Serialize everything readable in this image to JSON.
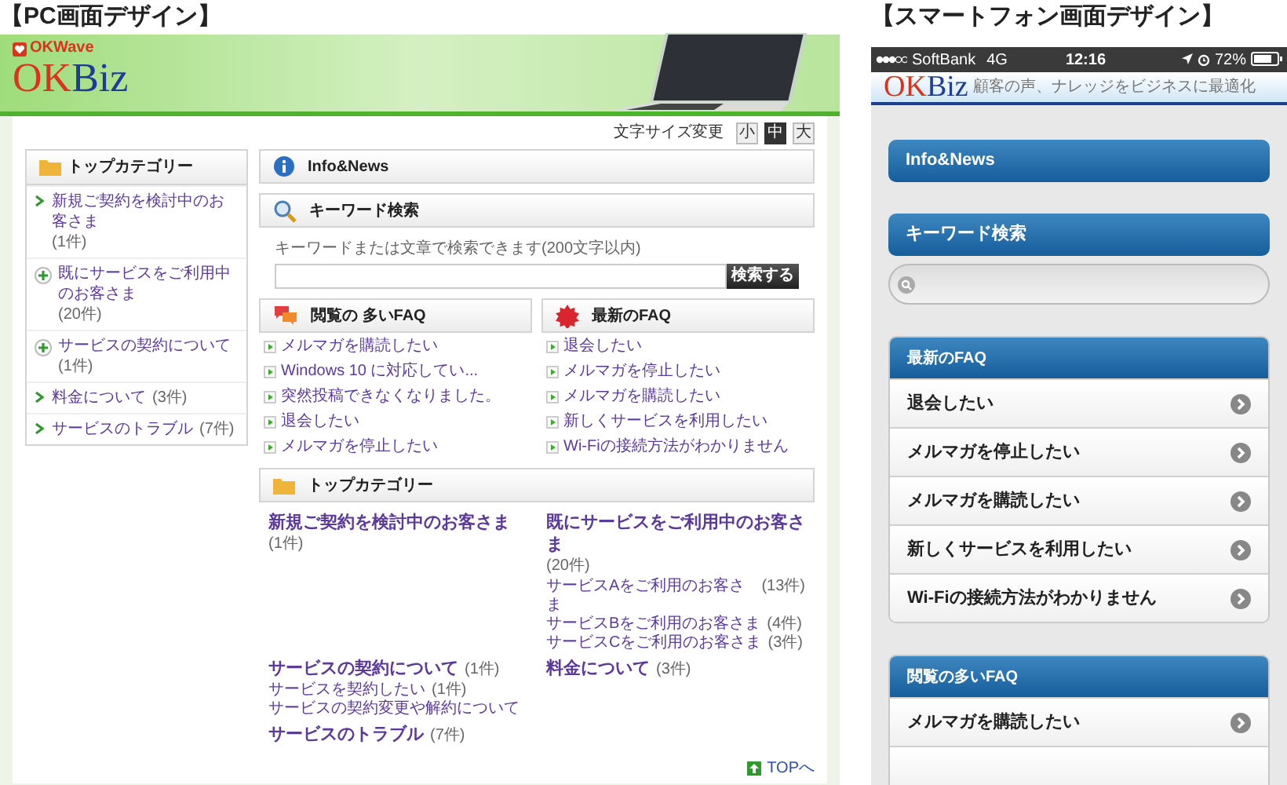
{
  "pc": {
    "title": "【PC画面デザイン】",
    "banner": {
      "brand": "OKWave",
      "logo_main": "OK",
      "logo_sub": "Biz"
    },
    "font_size": {
      "label": "文字サイズ変更",
      "options": [
        {
          "label": "小",
          "selected": false
        },
        {
          "label": "中",
          "selected": true
        },
        {
          "label": "大",
          "selected": false
        }
      ]
    },
    "sidebar": {
      "title": "トップカテゴリー",
      "items": [
        {
          "label": "新規ご契約を検討中のお客さま",
          "count": "(1件)",
          "kind": "arrow"
        },
        {
          "label": "既にサービスをご利用中のお客さま",
          "count": "(20件)",
          "kind": "plus"
        },
        {
          "label": "サービスの契約について",
          "count": "(1件)",
          "kind": "plus"
        },
        {
          "label": "料金について",
          "count": "(3件)",
          "kind": "arrow"
        },
        {
          "label": "サービスのトラブル",
          "count": "(7件)",
          "kind": "arrow"
        }
      ]
    },
    "info_title": "Info&News",
    "search": {
      "title": "キーワード検索",
      "hint": "キーワードまたは文章で検索できます(200文字以内)",
      "button": "検索する"
    },
    "faq_columns": [
      {
        "title": "閲覧の 多いFAQ",
        "kind": "popular",
        "items": [
          "メルマガを購読したい",
          "Windows 10 に対応してい...",
          "突然投稿できなくなりました。",
          "退会したい",
          "メルマガを停止したい"
        ]
      },
      {
        "title": "最新のFAQ",
        "kind": "new",
        "items": [
          "退会したい",
          "メルマガを停止したい",
          "メルマガを購読したい",
          "新しくサービスを利用したい",
          "Wi-Fiの接続方法がわかりません"
        ]
      }
    ],
    "categories": {
      "title": "トップカテゴリー",
      "items": [
        {
          "label": "新規ご契約を検討中のお客さま",
          "count": "(1件)"
        },
        {
          "label": "既にサービスをご利用中のお客さま",
          "count": "(20件)",
          "children": [
            {
              "label": "サービスAをご利用のお客さま",
              "count": "(13件)"
            },
            {
              "label": "サービスBをご利用のお客さま",
              "count": "(4件)"
            },
            {
              "label": "サービスCをご利用のお客さま",
              "count": "(3件)"
            }
          ]
        },
        {
          "label": "サービスの契約について",
          "count": "(1件)",
          "children": [
            {
              "label": "サービスを契約したい",
              "count": "(1件)"
            },
            {
              "label": "サービスの契約変更や解約について"
            }
          ]
        },
        {
          "label": "料金について",
          "count": "(3件)"
        },
        {
          "label": "サービスのトラブル",
          "count": "(7件)"
        }
      ]
    },
    "top_link": "TOPへ"
  },
  "phone": {
    "title": "【スマートフォン画面デザイン】",
    "status_bar": {
      "carrier": "SoftBank",
      "network": "4G",
      "time": "12:16",
      "battery": "72%"
    },
    "logo_main": "OK",
    "logo_sub": "Biz",
    "tagline": "顧客の声、ナレッジをビジネスに最適化",
    "info_title": "Info&News",
    "search_title": "キーワード検索",
    "panels": [
      {
        "title": "最新のFAQ",
        "items": [
          "退会したい",
          "メルマガを停止したい",
          "メルマガを購読したい",
          "新しくサービスを利用したい",
          "Wi-Fiの接続方法がわかりません"
        ]
      },
      {
        "title": "閲覧の多いFAQ",
        "items": [
          "メルマガを購読したい"
        ]
      }
    ]
  }
}
